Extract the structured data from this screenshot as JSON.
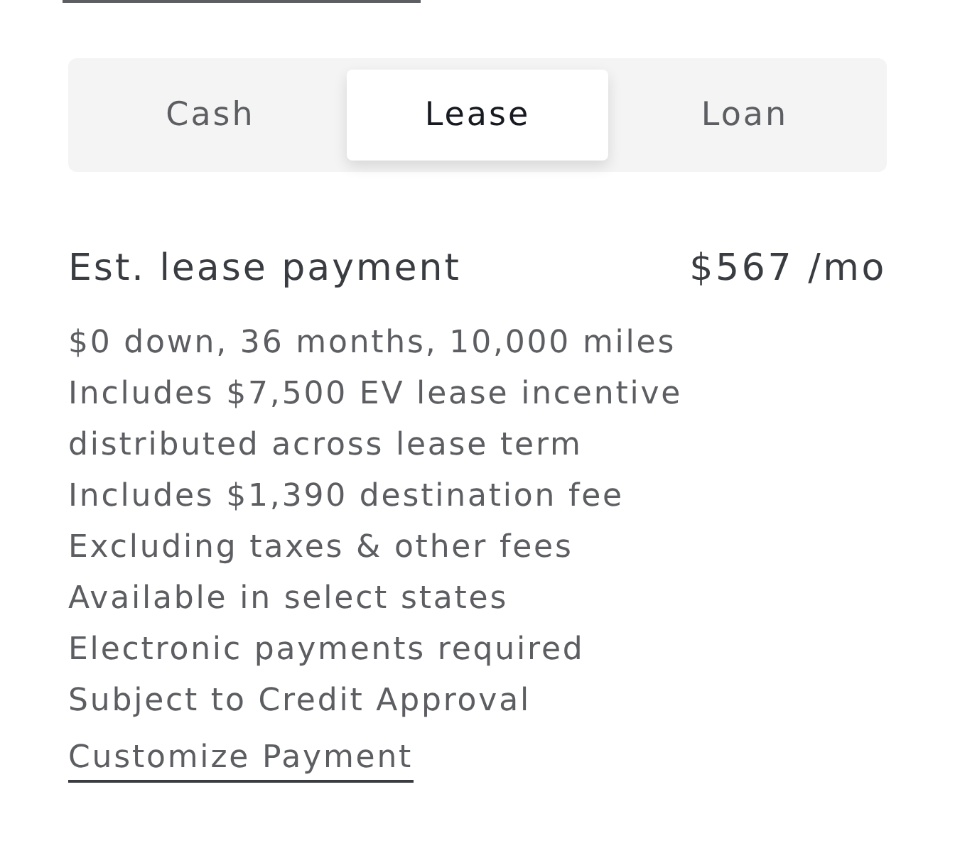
{
  "tabs": [
    {
      "label": "Cash",
      "selected": false
    },
    {
      "label": "Lease",
      "selected": true
    },
    {
      "label": "Loan",
      "selected": false
    }
  ],
  "payment": {
    "title": "Est. lease payment",
    "amount": "$567 /mo",
    "details": [
      "$0 down, 36 months, 10,000 miles",
      "Includes $7,500 EV lease incentive distributed across lease term",
      "Includes $1,390 destination fee",
      "Excluding taxes & other fees",
      "Available in select states",
      "Electronic payments required",
      "Subject to Credit Approval"
    ],
    "link": "Customize Payment"
  }
}
